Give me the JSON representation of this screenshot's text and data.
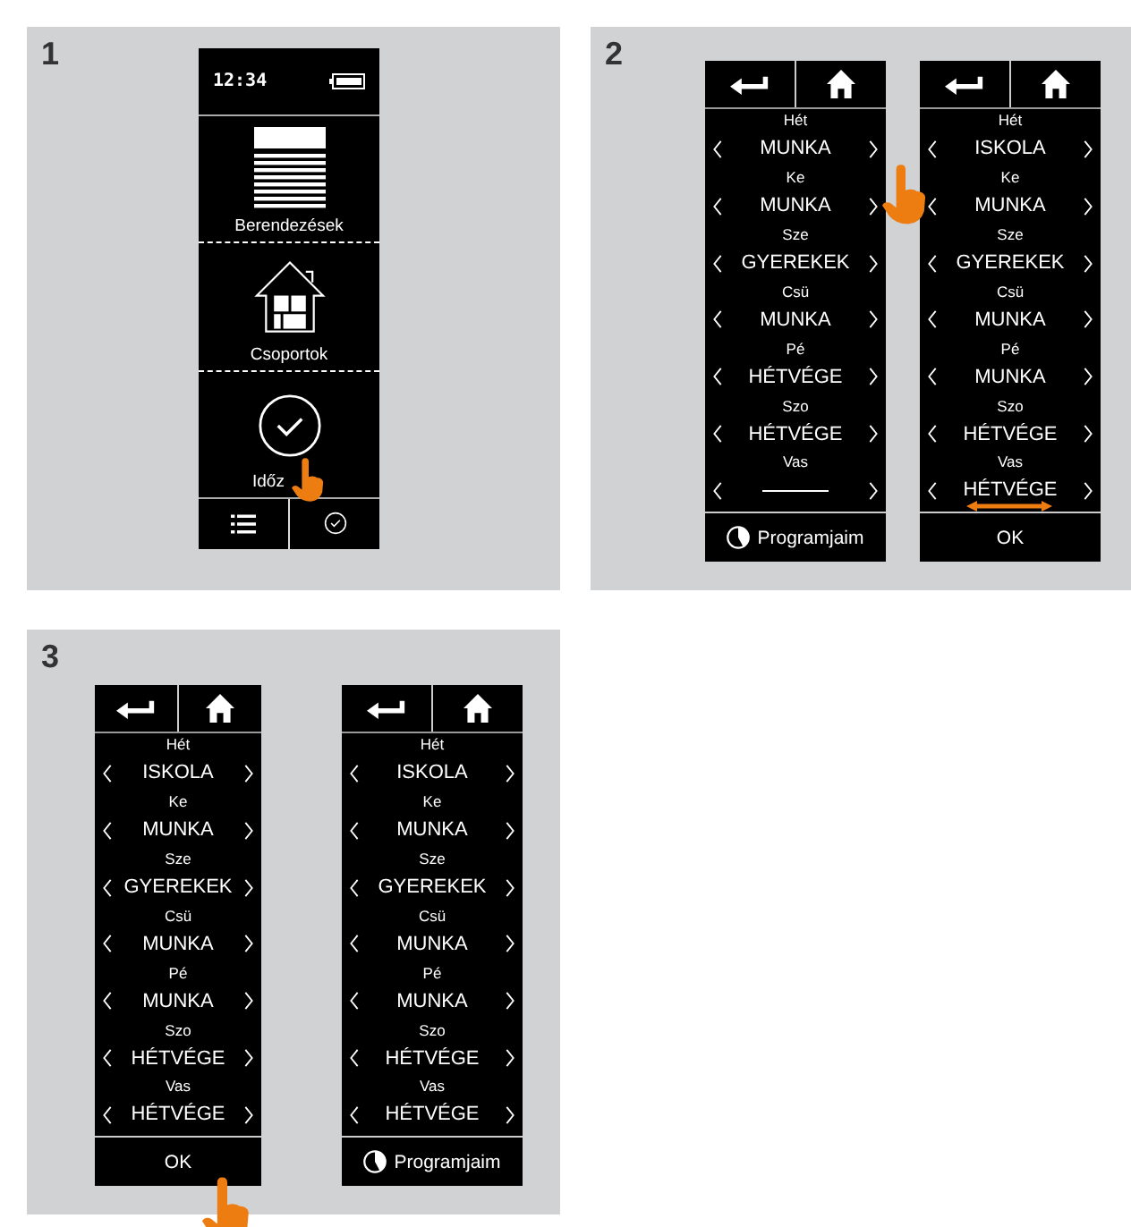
{
  "steps": [
    {
      "number": "1",
      "screens": [
        {
          "kind": "home",
          "time": "12:34",
          "items": [
            {
              "kind": "devices",
              "label": "Berendezések"
            },
            {
              "kind": "groups",
              "label": "Csoportok"
            },
            {
              "kind": "timer",
              "label": "Időz",
              "gesture": {
                "kind": "tap"
              }
            }
          ]
        }
      ]
    },
    {
      "number": "2",
      "screens": [
        {
          "kind": "schedule",
          "days": [
            {
              "day": "Hét",
              "value": "MUNKA",
              "gesture": {
                "kind": "tap"
              }
            },
            {
              "day": "Ke",
              "value": "MUNKA"
            },
            {
              "day": "Sze",
              "value": "GYEREKEK"
            },
            {
              "day": "Csü",
              "value": "MUNKA"
            },
            {
              "day": "Pé",
              "value": "HÉTVÉGE"
            },
            {
              "day": "Szo",
              "value": "HÉTVÉGE"
            },
            {
              "day": "Vas",
              "kind": "empty"
            }
          ],
          "footer": {
            "kind": "programs",
            "label": "Programjaim"
          }
        },
        {
          "kind": "schedule",
          "days": [
            {
              "day": "Hét",
              "value": "ISKOLA"
            },
            {
              "day": "Ke",
              "value": "MUNKA"
            },
            {
              "day": "Sze",
              "value": "GYEREKEK"
            },
            {
              "day": "Csü",
              "value": "MUNKA"
            },
            {
              "day": "Pé",
              "value": "MUNKA"
            },
            {
              "day": "Szo",
              "value": "HÉTVÉGE"
            },
            {
              "day": "Vas",
              "value": "HÉTVÉGE",
              "gesture": {
                "kind": "swipe"
              }
            }
          ],
          "footer": {
            "kind": "ok",
            "label": "OK"
          }
        }
      ]
    },
    {
      "number": "3",
      "screens": [
        {
          "kind": "schedule",
          "days": [
            {
              "day": "Hét",
              "value": "ISKOLA"
            },
            {
              "day": "Ke",
              "value": "MUNKA"
            },
            {
              "day": "Sze",
              "value": "GYEREKEK"
            },
            {
              "day": "Csü",
              "value": "MUNKA"
            },
            {
              "day": "Pé",
              "value": "MUNKA"
            },
            {
              "day": "Szo",
              "value": "HÉTVÉGE"
            },
            {
              "day": "Vas",
              "value": "HÉTVÉGE"
            }
          ],
          "footer": {
            "kind": "ok",
            "label": "OK",
            "gesture": {
              "kind": "tap"
            }
          }
        },
        {
          "kind": "schedule",
          "days": [
            {
              "day": "Hét",
              "value": "ISKOLA"
            },
            {
              "day": "Ke",
              "value": "MUNKA"
            },
            {
              "day": "Sze",
              "value": "GYEREKEK"
            },
            {
              "day": "Csü",
              "value": "MUNKA"
            },
            {
              "day": "Pé",
              "value": "MUNKA"
            },
            {
              "day": "Szo",
              "value": "HÉTVÉGE"
            },
            {
              "day": "Vas",
              "value": "HÉTVÉGE"
            }
          ],
          "footer": {
            "kind": "programs",
            "label": "Programjaim"
          }
        }
      ]
    }
  ]
}
